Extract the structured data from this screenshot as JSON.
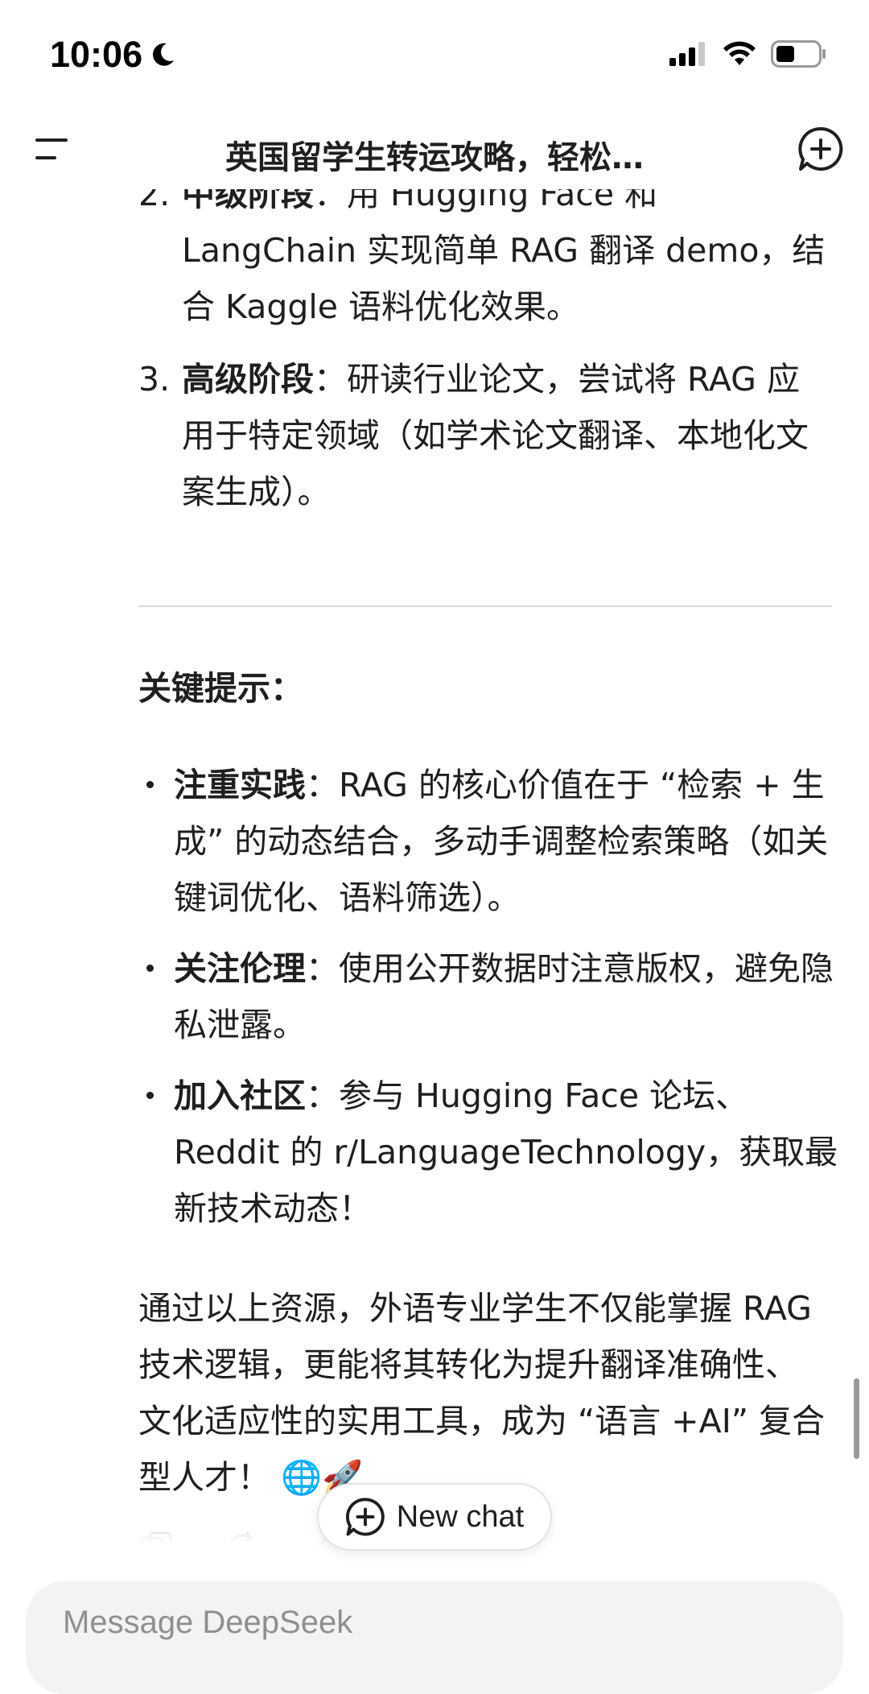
{
  "status_bar": {
    "time": "10:06"
  },
  "header": {
    "title": "英国留学生转运攻略，轻松…"
  },
  "content": {
    "ol_items": [
      {
        "number": "2.",
        "bold": "中级阶段",
        "sep": "：",
        "text": "用 Hugging Face 和 LangChain 实现简单 RAG 翻译 demo，结合 Kaggle 语料优化效果。"
      },
      {
        "number": "3.",
        "bold": "高级阶段",
        "sep": "：",
        "text": "研读行业论文，尝试将 RAG 应用于特定领域（如学术论文翻译、本地化文案生成）。"
      }
    ],
    "section_heading": "关键提示：",
    "bullets": [
      {
        "bold": "注重实践",
        "sep": "：",
        "text": "RAG 的核心价值在于 “检索 + 生成” 的动态结合，多动手调整检索策略（如关键词优化、语料筛选）。"
      },
      {
        "bold": "关注伦理",
        "sep": "：",
        "text": "使用公开数据时注意版权，避免隐私泄露。"
      },
      {
        "bold": "加入社区",
        "sep": "：",
        "text": "参与 Hugging Face 论坛、Reddit 的 r/LanguageTechnology，获取最新技术动态！"
      }
    ],
    "closing_paragraph": "通过以上资源，外语专业学生不仅能掌握 RAG 技术逻辑，更能将其转化为提升翻译准确性、文化适应性的实用工具，成为 “语言 +AI” 复合型人才！ 🌐🚀"
  },
  "new_chat_button": {
    "label": "New chat"
  },
  "composer": {
    "placeholder": "Message DeepSeek"
  },
  "icons": {
    "menu": "menu-icon",
    "new_chat": "new-chat-icon",
    "moon": "moon-icon",
    "signal": "signal-icon",
    "wifi": "wifi-icon",
    "battery": "battery-icon"
  }
}
